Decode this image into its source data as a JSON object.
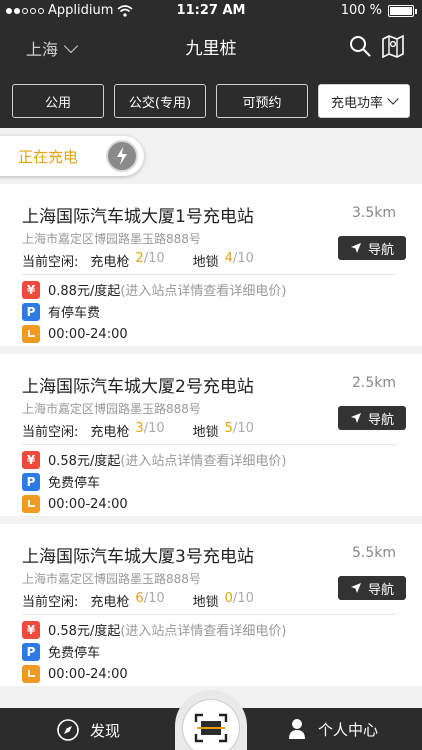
{
  "status_bar": {
    "carrier": "Applidium",
    "time": "11:27 AM",
    "battery": "100 %"
  },
  "header": {
    "city": "上海",
    "title": "九里桩"
  },
  "filters": [
    {
      "label": "公用"
    },
    {
      "label": "公交(专用)"
    },
    {
      "label": "可预约"
    },
    {
      "label": "充电功率"
    }
  ],
  "charging_pill": {
    "label": "正在充电"
  },
  "stations": [
    {
      "name": "上海国际汽车城大厦1号充电站",
      "distance": "3.5km",
      "address": "上海市嘉定区博园路墨玉路888号",
      "idle_label": "当前空闲:",
      "gun_label": "充电枪",
      "gun_free": "2",
      "gun_total": "10",
      "lock_label": "地锁",
      "lock_free": "4",
      "lock_total": "10",
      "nav_label": "导航",
      "price": "0.88元/度起",
      "price_note": "(进入站点详情查看详细电价)",
      "parking": "有停车费",
      "hours": "00:00-24:00"
    },
    {
      "name": "上海国际汽车城大厦2号充电站",
      "distance": "2.5km",
      "address": "上海市嘉定区博园路墨玉路888号",
      "idle_label": "当前空闲:",
      "gun_label": "充电枪",
      "gun_free": "3",
      "gun_total": "10",
      "lock_label": "地锁",
      "lock_free": "5",
      "lock_total": "10",
      "nav_label": "导航",
      "price": "0.58元/度起",
      "price_note": "(进入站点详情查看详细电价)",
      "parking": "免费停车",
      "hours": "00:00-24:00"
    },
    {
      "name": "上海国际汽车城大厦3号充电站",
      "distance": "5.5km",
      "address": "上海市嘉定区博园路墨玉路888号",
      "idle_label": "当前空闲:",
      "gun_label": "充电枪",
      "gun_free": "6",
      "gun_total": "10",
      "lock_label": "地锁",
      "lock_free": "0",
      "lock_total": "10",
      "nav_label": "导航",
      "price": "0.58元/度起",
      "price_note": "(进入站点详情查看详细电价)",
      "parking": "免费停车",
      "hours": "00:00-24:00"
    }
  ],
  "tabbar": {
    "discover": "发现",
    "profile": "个人中心"
  },
  "colors": {
    "dark": "#2c2c2c",
    "accent": "#e6a10f",
    "yen": "#f04a3a",
    "park": "#2c7be5",
    "clock": "#f19a22"
  }
}
